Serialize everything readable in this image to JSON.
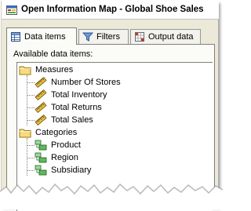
{
  "window": {
    "title": "Open Information Map - Global Shoe Sales",
    "title_icon": "information-map-icon"
  },
  "tabs": [
    {
      "label": "Data items",
      "icon": "data-items-icon",
      "active": true
    },
    {
      "label": "Filters",
      "icon": "filter-funnel-icon",
      "active": false
    },
    {
      "label": "Output data",
      "icon": "output-data-icon",
      "active": false
    }
  ],
  "panel": {
    "available_label": "Available data items:"
  },
  "tree": {
    "measures": {
      "label": "Measures",
      "icon": "folder-icon",
      "items": [
        {
          "label": "Number Of Stores",
          "icon": "measure-ruler-icon"
        },
        {
          "label": "Total Inventory",
          "icon": "measure-ruler-icon"
        },
        {
          "label": "Total Returns",
          "icon": "measure-ruler-icon"
        },
        {
          "label": "Total Sales",
          "icon": "measure-ruler-icon"
        }
      ]
    },
    "categories": {
      "label": "Categories",
      "icon": "folder-icon",
      "items": [
        {
          "label": "Product",
          "icon": "category-hierarchy-icon"
        },
        {
          "label": "Region",
          "icon": "category-hierarchy-icon"
        },
        {
          "label": "Subsidiary",
          "icon": "category-hierarchy-icon"
        }
      ]
    }
  },
  "colors": {
    "dialog_face": "#ece9d8",
    "tab_face": "#fbfbf8",
    "folder": "#f4d46a",
    "measure": "#e8b820",
    "category": "#4caf50"
  }
}
